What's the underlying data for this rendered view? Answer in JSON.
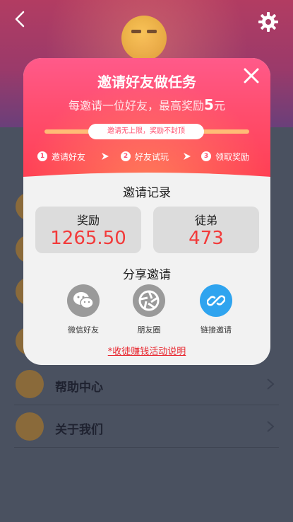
{
  "background": {
    "menu": [
      {
        "label": ""
      },
      {
        "label": ""
      },
      {
        "label": ""
      },
      {
        "label": ""
      },
      {
        "label": "帮助中心"
      },
      {
        "label": "关于我们"
      }
    ]
  },
  "modal": {
    "title": "邀请好友做任务",
    "subtitle_prefix": "每邀请一位好友，最高奖励",
    "subtitle_amount": "5",
    "subtitle_unit": "元",
    "pill_text": "邀请无上限，奖励不封顶",
    "steps": [
      {
        "num": "1",
        "label": "邀请好友"
      },
      {
        "num": "2",
        "label": "好友试玩"
      },
      {
        "num": "3",
        "label": "领取奖励"
      }
    ],
    "records_title": "邀请记录",
    "stats": {
      "reward_label": "奖励",
      "reward_value": "1265.50",
      "disciples_label": "徒弟",
      "disciples_value": "473"
    },
    "share_title": "分享邀请",
    "share": [
      {
        "label": "微信好友",
        "icon": "wechat-icon"
      },
      {
        "label": "朋友圈",
        "icon": "moments-icon"
      },
      {
        "label": "链接邀请",
        "icon": "link-icon"
      }
    ],
    "rules_link": "*收徒赚钱活动说明"
  },
  "colors": {
    "accent_pink": "#ff4d6d",
    "value_red": "#f23a3a",
    "link_blue": "#2fa4ef",
    "icon_gray": "#9a9a9a"
  }
}
